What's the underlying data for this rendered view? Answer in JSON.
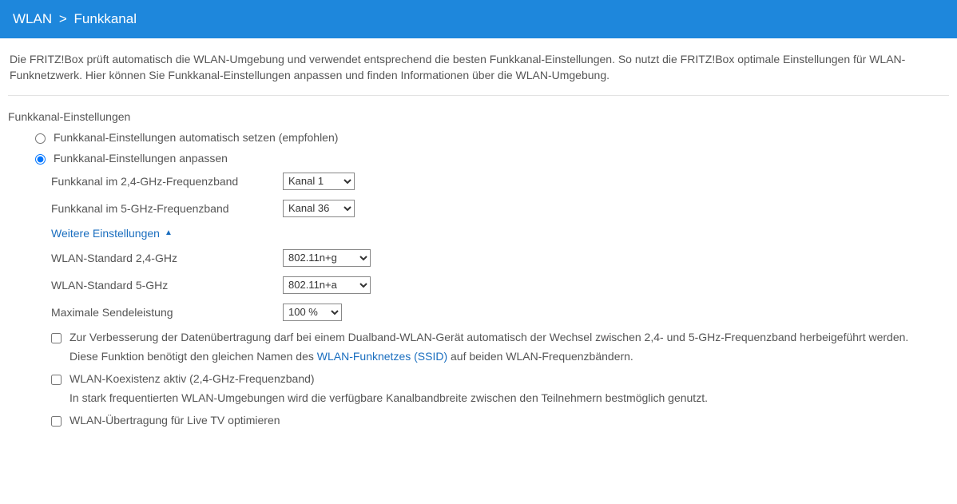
{
  "breadcrumb": {
    "parent": "WLAN",
    "separator": ">",
    "current": "Funkkanal"
  },
  "intro_text": "Die FRITZ!Box prüft automatisch die WLAN-Umgebung und verwendet entsprechend die besten Funkkanal-Einstellungen. So nutzt die FRITZ!Box optimale Einstellungen für WLAN-Funknetzwerk. Hier können Sie Funkkanal-Einstellungen anpassen und finden Informationen über die WLAN-Umgebung.",
  "section_title": "Funkkanal-Einstellungen",
  "radio": {
    "auto_label": "Funkkanal-Einstellungen automatisch setzen (empfohlen)",
    "custom_label": "Funkkanal-Einstellungen anpassen"
  },
  "settings": {
    "ch_24_label": "Funkkanal im 2,4-GHz-Frequenzband",
    "ch_24_value": "Kanal 1",
    "ch_5_label": "Funkkanal im 5-GHz-Frequenzband",
    "ch_5_value": "Kanal 36",
    "more_label": "Weitere Einstellungen",
    "std_24_label": "WLAN-Standard 2,4-GHz",
    "std_24_value": "802.11n+g",
    "std_5_label": "WLAN-Standard 5-GHz",
    "std_5_value": "802.11n+a",
    "power_label": "Maximale Sendeleistung",
    "power_value": "100 %"
  },
  "checks": {
    "bandswitch_label": "Zur Verbesserung der Datenübertragung darf bei einem Dualband-WLAN-Gerät automatisch der Wechsel zwischen 2,4- und 5-GHz-Frequenzband herbeigeführt werden.",
    "bandswitch_sub_prefix": "Diese Funktion benötigt den gleichen Namen des ",
    "bandswitch_sub_link": "WLAN-Funknetzes (SSID)",
    "bandswitch_sub_suffix": " auf beiden WLAN-Frequenzbändern.",
    "coexist_label": "WLAN-Koexistenz aktiv (2,4-GHz-Frequenzband)",
    "coexist_sub": "In stark frequentierten WLAN-Umgebungen wird die verfügbare Kanalbandbreite zwischen den Teilnehmern bestmöglich genutzt.",
    "livetv_label": "WLAN-Übertragung für Live TV optimieren"
  }
}
